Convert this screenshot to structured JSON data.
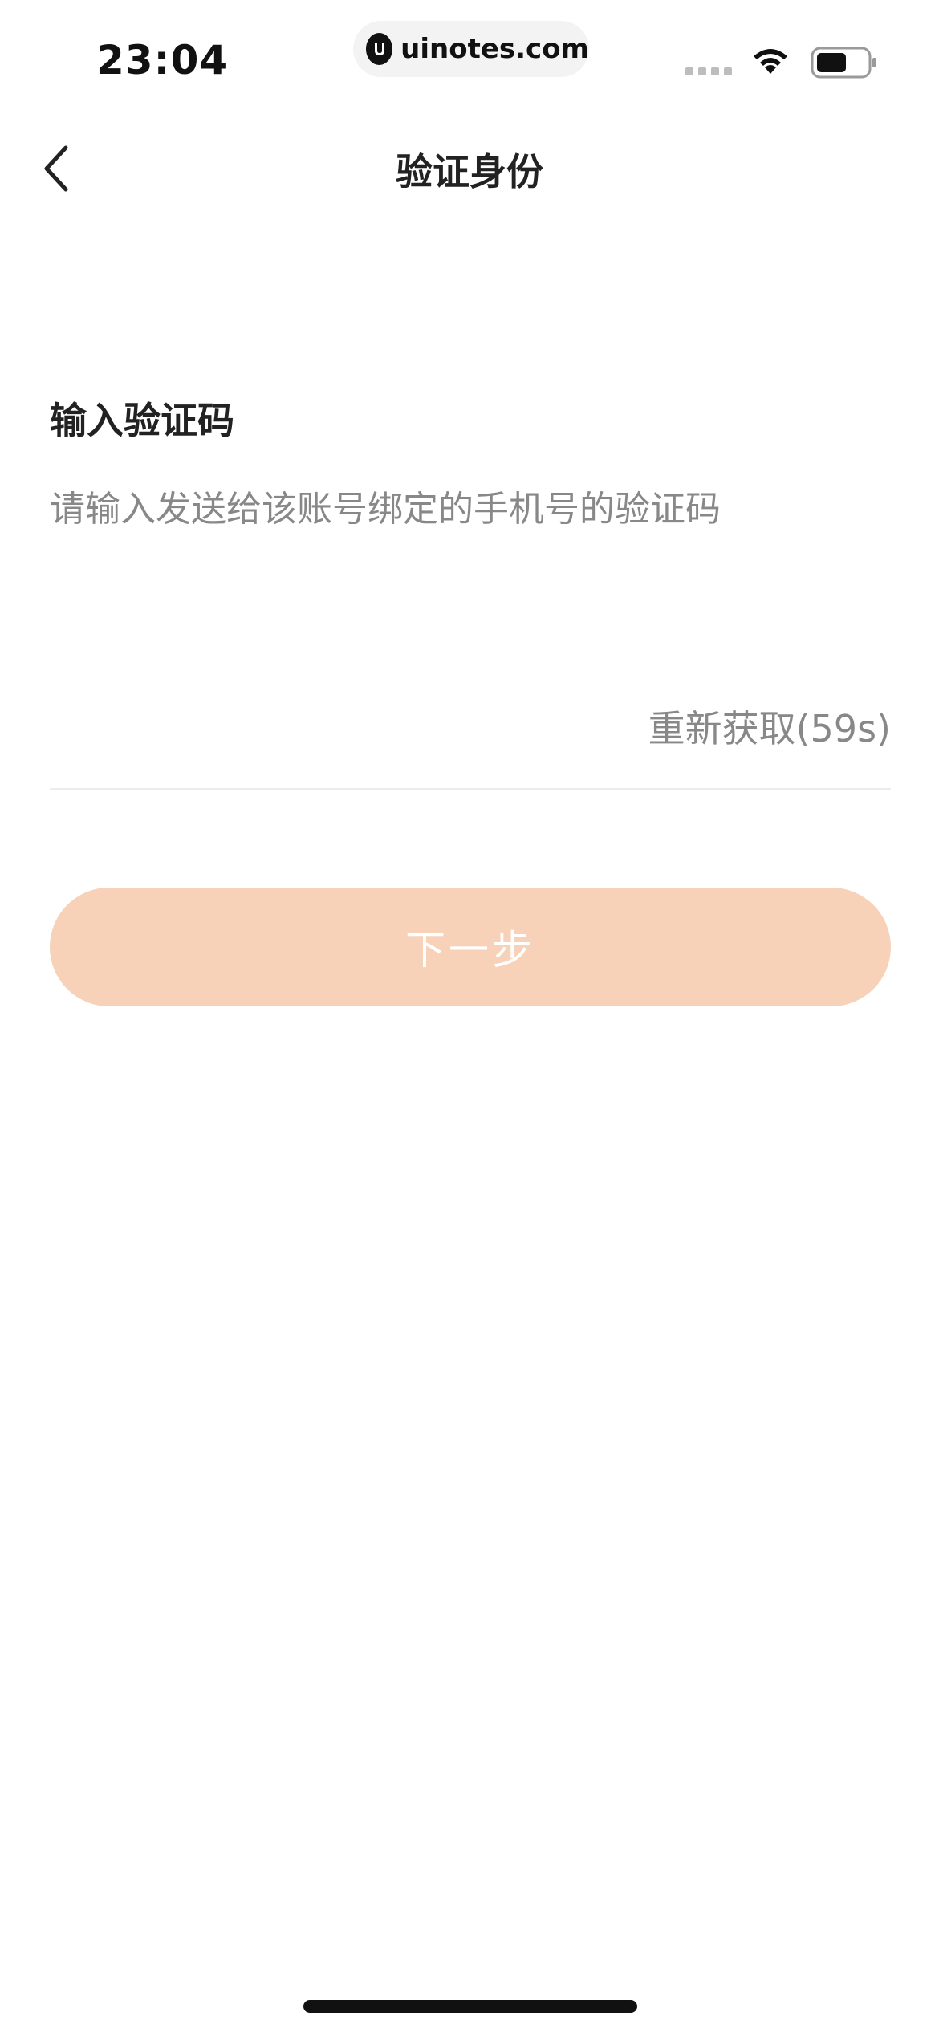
{
  "status_bar": {
    "time": "23:04",
    "url": "uinotes.com",
    "icons": [
      "signal-icon",
      "wifi-icon",
      "battery-icon"
    ]
  },
  "nav": {
    "title": "验证身份",
    "back_icon": "chevron-left-icon"
  },
  "verify": {
    "title": "输入验证码",
    "description": "请输入发送给该账号绑定的手机号的验证码",
    "code_value": "",
    "resend_label": "重新获取(59s)"
  },
  "next_button": {
    "label": "下一步",
    "color": "#f7d1b8",
    "disabled": true
  }
}
